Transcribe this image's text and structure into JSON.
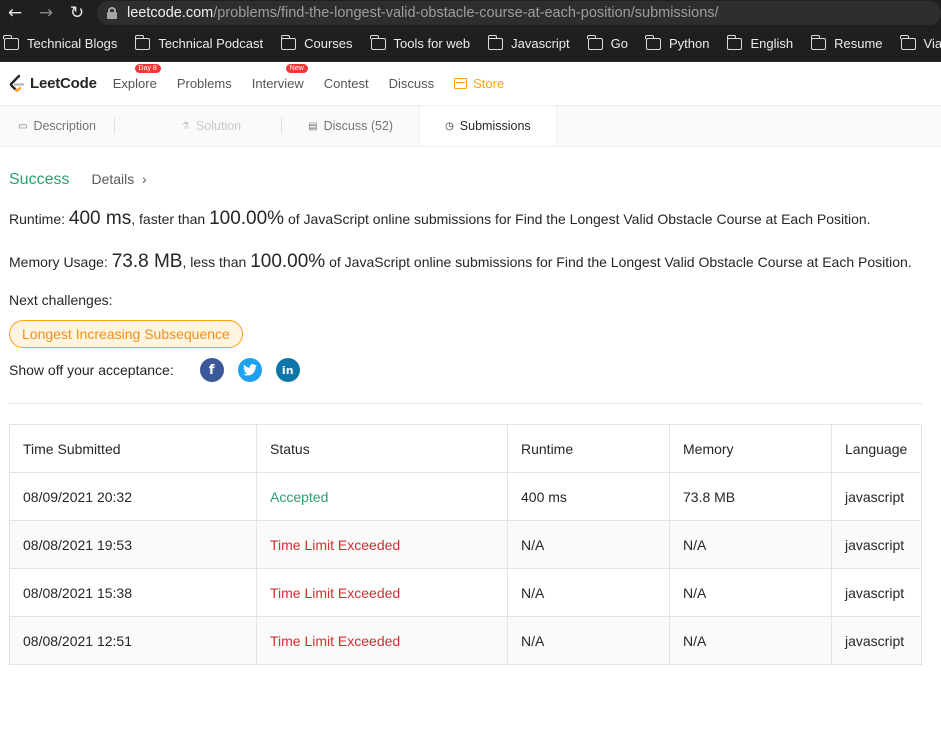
{
  "browser": {
    "url_host": "leetcode.com",
    "url_path": "/problems/find-the-longest-valid-obstacle-course-at-each-position/submissions/",
    "bookmarks": [
      "Technical Blogs",
      "Technical Podcast",
      "Courses",
      "Tools for web",
      "Javascript",
      "Go",
      "Python",
      "English",
      "Resume",
      "Viatick"
    ]
  },
  "nav": {
    "logo": "LeetCode",
    "explore": "Explore",
    "explore_badge": "Day 8",
    "problems": "Problems",
    "interview": "Interview",
    "interview_badge": "New",
    "contest": "Contest",
    "discuss": "Discuss",
    "store": "Store"
  },
  "tabs": {
    "description": "Description",
    "solution": "Solution",
    "discuss": "Discuss (52)",
    "submissions": "Submissions"
  },
  "result": {
    "status": "Success",
    "details": "Details",
    "runtime_label": "Runtime:",
    "runtime_value": "400 ms",
    "runtime_mid": ", faster than",
    "runtime_pct": "100.00%",
    "runtime_tail": "of JavaScript online submissions for Find the Longest Valid Obstacle Course at Each Position.",
    "memory_label": "Memory Usage:",
    "memory_value": "73.8 MB",
    "memory_mid": ", less than",
    "memory_pct": "100.00%",
    "memory_tail": "of JavaScript online submissions for Find the Longest Valid Obstacle Course at Each Position.",
    "next_label": "Next challenges:",
    "challenge": "Longest Increasing Subsequence",
    "share_label": "Show off your acceptance:"
  },
  "table": {
    "headers": [
      "Time Submitted",
      "Status",
      "Runtime",
      "Memory",
      "Language"
    ],
    "rows": [
      [
        "08/09/2021 20:32",
        "Accepted",
        "400 ms",
        "73.8 MB",
        "javascript"
      ],
      [
        "08/08/2021 19:53",
        "Time Limit Exceeded",
        "N/A",
        "N/A",
        "javascript"
      ],
      [
        "08/08/2021 15:38",
        "Time Limit Exceeded",
        "N/A",
        "N/A",
        "javascript"
      ],
      [
        "08/08/2021 12:51",
        "Time Limit Exceeded",
        "N/A",
        "N/A",
        "javascript"
      ]
    ]
  },
  "colors": {
    "accepted": "#2e9e6f",
    "error": "#d32f2f",
    "brand_orange": "#ffa116"
  }
}
